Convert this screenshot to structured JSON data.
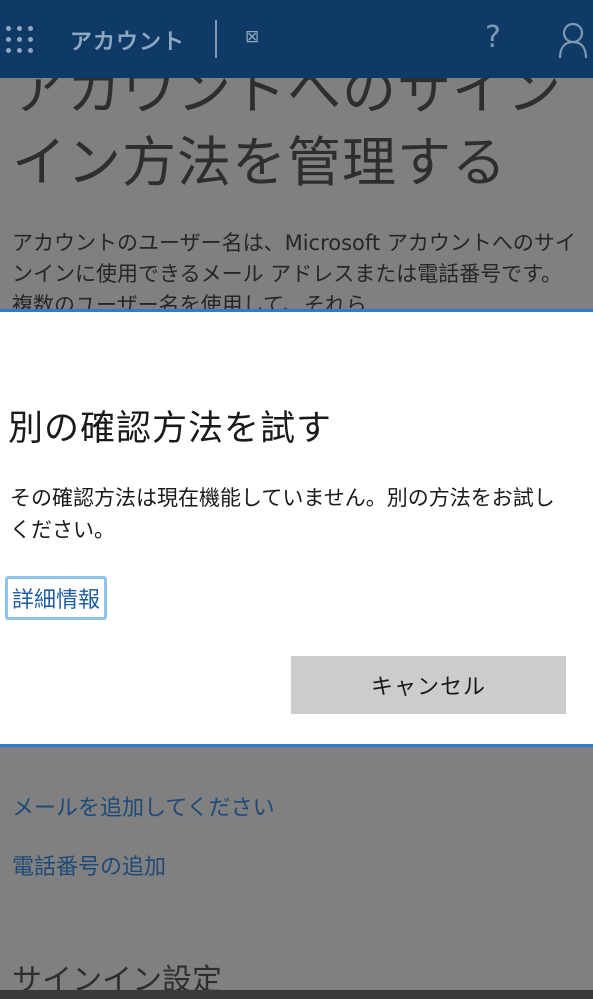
{
  "header": {
    "brand": "アカウント",
    "broken_image_glyph": "⊠",
    "help_glyph": "?",
    "icons": [
      "waffle-menu-icon",
      "broken-image-icon",
      "help-icon",
      "account-icon"
    ],
    "bg_color": "#0f3a66"
  },
  "background_page": {
    "heading": "アカウントへのサインイン方法を管理する",
    "paragraph": "アカウントのユーザー名は、Microsoft アカウントへのサインインに使用できるメール アドレスまたは電話番号です。複数のユーザー名を使用して、それら",
    "add_email_link": "メールを追加してください",
    "add_phone_link": "電話番号の追加",
    "signin_settings_heading": "サインイン設定"
  },
  "dialog": {
    "title": "別の確認方法を試す",
    "body": "その確認方法は現在機能していません。別の方法をお試しください。",
    "more_info_link": "詳細情報",
    "cancel_label": "キャンセル",
    "accent_color": "#2f7bd0"
  }
}
